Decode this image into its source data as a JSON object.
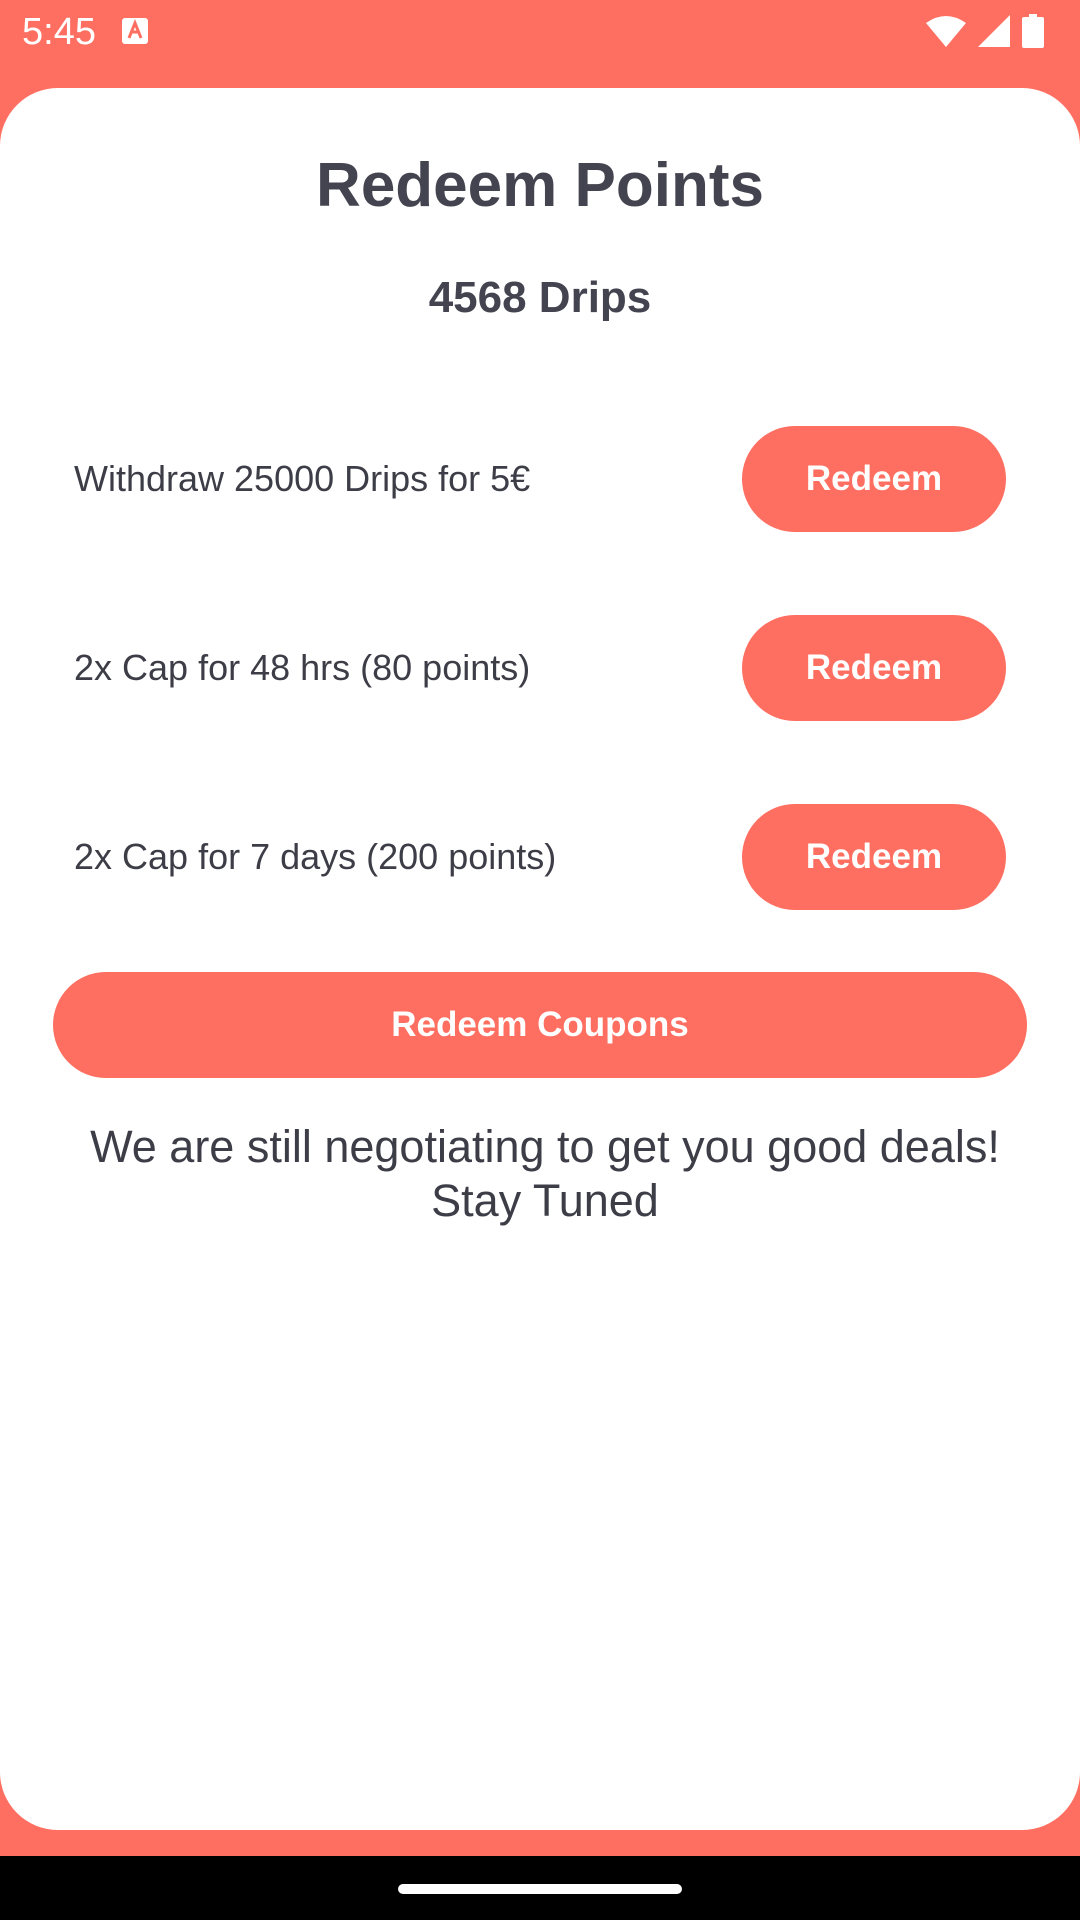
{
  "status_bar": {
    "time": "5:45",
    "notification_icon": "a-icon",
    "wifi_icon": "wifi-icon",
    "signal_icon": "signal-icon",
    "battery_icon": "battery-icon"
  },
  "page": {
    "title": "Redeem Points",
    "balance": "4568 Drips"
  },
  "rewards": [
    {
      "label": "Withdraw 25000 Drips for 5€",
      "button": "Redeem"
    },
    {
      "label": "2x Cap for 48 hrs (80 points)",
      "button": "Redeem"
    },
    {
      "label": "2x Cap for 7 days (200 points)",
      "button": "Redeem"
    }
  ],
  "coupons_button": "Redeem Coupons",
  "notice": {
    "line1": "We are still negotiating to get you good deals!",
    "line2": "Stay Tuned"
  },
  "colors": {
    "accent": "#FF6F61",
    "text": "#444450",
    "card": "#FFFFFF"
  }
}
